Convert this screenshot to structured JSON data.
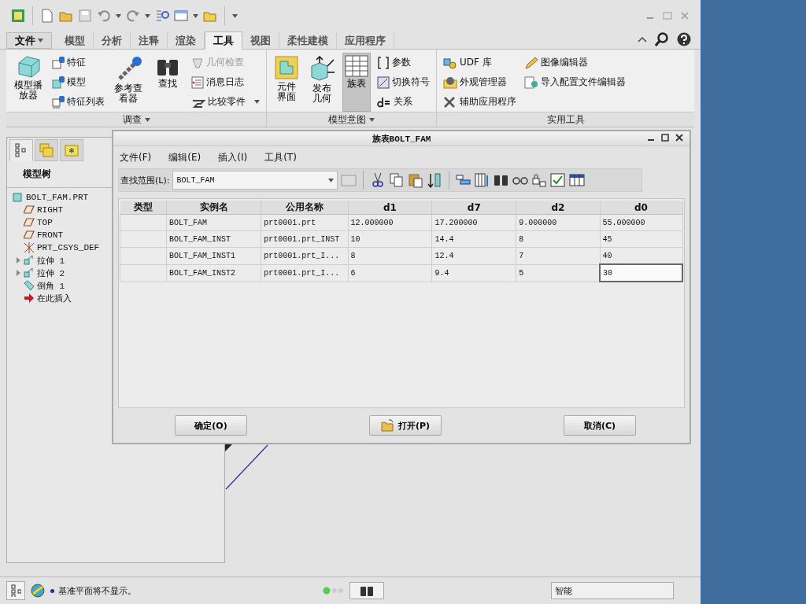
{
  "ribbon": {
    "tabs": [
      {
        "label": "文件",
        "kind": "menu",
        "selected": false
      },
      {
        "label": "模型",
        "kind": "tab",
        "selected": false
      },
      {
        "label": "分析",
        "kind": "tab",
        "selected": false
      },
      {
        "label": "注释",
        "kind": "tab",
        "selected": false
      },
      {
        "label": "渲染",
        "kind": "tab",
        "selected": false
      },
      {
        "label": "工具",
        "kind": "tab",
        "selected": true
      },
      {
        "label": "视图",
        "kind": "tab",
        "selected": false
      },
      {
        "label": "柔性建模",
        "kind": "tab",
        "selected": false
      },
      {
        "label": "应用程序",
        "kind": "tab",
        "selected": false
      }
    ],
    "groups": [
      {
        "label": "调查",
        "dropdown": true,
        "columns": [
          {
            "kind": "large",
            "items": [
              {
                "label": "模型播放器",
                "pressed": false
              }
            ]
          },
          {
            "kind": "small",
            "items": [
              {
                "label": "特征",
                "disabled": false,
                "dropdown": false
              },
              {
                "label": "模型",
                "disabled": false,
                "dropdown": false
              },
              {
                "label": "特征列表",
                "disabled": false,
                "dropdown": false
              }
            ]
          },
          {
            "kind": "large",
            "items": [
              {
                "label": "参考查看器",
                "pressed": false
              }
            ]
          },
          {
            "kind": "large",
            "items": [
              {
                "label": "查找",
                "pressed": false
              }
            ]
          },
          {
            "kind": "small",
            "items": [
              {
                "label": "几何检查",
                "disabled": true,
                "dropdown": false
              },
              {
                "label": "消息日志",
                "disabled": false,
                "dropdown": false
              },
              {
                "label": "比较零件",
                "disabled": false,
                "dropdown": true
              }
            ]
          }
        ]
      },
      {
        "label": "模型意图",
        "dropdown": true,
        "columns": [
          {
            "kind": "large",
            "items": [
              {
                "label": "元件界面",
                "pressed": false
              }
            ]
          },
          {
            "kind": "large",
            "items": [
              {
                "label": "发布几何",
                "pressed": false
              }
            ]
          },
          {
            "kind": "large",
            "items": [
              {
                "label": "族表",
                "pressed": true
              }
            ]
          },
          {
            "kind": "small",
            "items": [
              {
                "label": "参数",
                "disabled": false,
                "dropdown": false
              },
              {
                "label": "切换符号",
                "disabled": false,
                "dropdown": false
              },
              {
                "label": "关系",
                "disabled": false,
                "dropdown": false
              }
            ]
          }
        ]
      },
      {
        "label": "实用工具",
        "dropdown": false,
        "columns": [
          {
            "kind": "small",
            "items": [
              {
                "label": "UDF 库",
                "disabled": false,
                "dropdown": false
              },
              {
                "label": "外观管理器",
                "disabled": false,
                "dropdown": false
              },
              {
                "label": "辅助应用程序",
                "disabled": false,
                "dropdown": false
              }
            ]
          },
          {
            "kind": "small",
            "items": [
              {
                "label": "图像编辑器",
                "disabled": false,
                "dropdown": false
              },
              {
                "label": "导入配置文件编辑器",
                "disabled": false,
                "dropdown": false
              }
            ]
          }
        ]
      }
    ]
  },
  "model_tree": {
    "tabs": [
      {
        "kind": "tree",
        "selected": true
      },
      {
        "kind": "layers",
        "selected": false
      },
      {
        "kind": "favorites",
        "selected": false
      }
    ],
    "title": "模型树",
    "items": [
      {
        "label": "BOLT_FAM.PRT",
        "kind": "part",
        "children": [
          {
            "label": "RIGHT",
            "kind": "plane"
          },
          {
            "label": "TOP",
            "kind": "plane"
          },
          {
            "label": "FRONT",
            "kind": "plane"
          },
          {
            "label": "PRT_CSYS_DEF",
            "kind": "csys"
          },
          {
            "label": "拉伸 1",
            "kind": "extrude",
            "expanded": false
          },
          {
            "label": "拉伸 2",
            "kind": "extrude",
            "expanded": false
          },
          {
            "label": "倒角 1",
            "kind": "chamfer"
          },
          {
            "label": "在此插入",
            "kind": "insert"
          }
        ]
      }
    ]
  },
  "dialog": {
    "title": "族表BOLT_FAM",
    "menu": [
      "文件(F)",
      "编辑(E)",
      "插入(I)",
      "工具(T)"
    ],
    "look_in": {
      "label": "查找范围(L):",
      "value": "BOLT_FAM"
    },
    "table": {
      "columns": [
        "类型",
        "实例名",
        "公用名称",
        "d1",
        "d7",
        "d2",
        "d0"
      ],
      "rows": [
        {
          "cells": [
            {
              "text": "",
              "selected": false
            },
            {
              "text": "BOLT_FAM",
              "selected": false
            },
            {
              "text": "prt0001.prt",
              "selected": false
            },
            {
              "text": "12.000000",
              "selected": false
            },
            {
              "text": "17.200000",
              "selected": false
            },
            {
              "text": "9.000000",
              "selected": false
            },
            {
              "text": "55.000000",
              "selected": false
            }
          ]
        },
        {
          "cells": [
            {
              "text": "",
              "selected": false
            },
            {
              "text": "BOLT_FAM_INST",
              "selected": false
            },
            {
              "text": "prt0001.prt_INST",
              "selected": false
            },
            {
              "text": "10",
              "selected": false
            },
            {
              "text": "14.4",
              "selected": false
            },
            {
              "text": "8",
              "selected": false
            },
            {
              "text": "45",
              "selected": false
            }
          ]
        },
        {
          "cells": [
            {
              "text": "",
              "selected": false
            },
            {
              "text": "BOLT_FAM_INST1",
              "selected": false
            },
            {
              "text": "prt0001.prt_I...",
              "selected": false
            },
            {
              "text": "8",
              "selected": false
            },
            {
              "text": "12.4",
              "selected": false
            },
            {
              "text": "7",
              "selected": false
            },
            {
              "text": "40",
              "selected": false
            }
          ]
        },
        {
          "cells": [
            {
              "text": "",
              "selected": false
            },
            {
              "text": "BOLT_FAM_INST2",
              "selected": false
            },
            {
              "text": "prt0001.prt_I...",
              "selected": false
            },
            {
              "text": "6",
              "selected": false
            },
            {
              "text": "9.4",
              "selected": false
            },
            {
              "text": "5",
              "selected": false
            },
            {
              "text": "30",
              "selected": true
            }
          ]
        }
      ]
    },
    "buttons": [
      "确定(O)",
      "打开(P)",
      "取消(C)"
    ]
  },
  "status_bar": {
    "message": "基准平面将不显示。",
    "filter": "智能"
  }
}
